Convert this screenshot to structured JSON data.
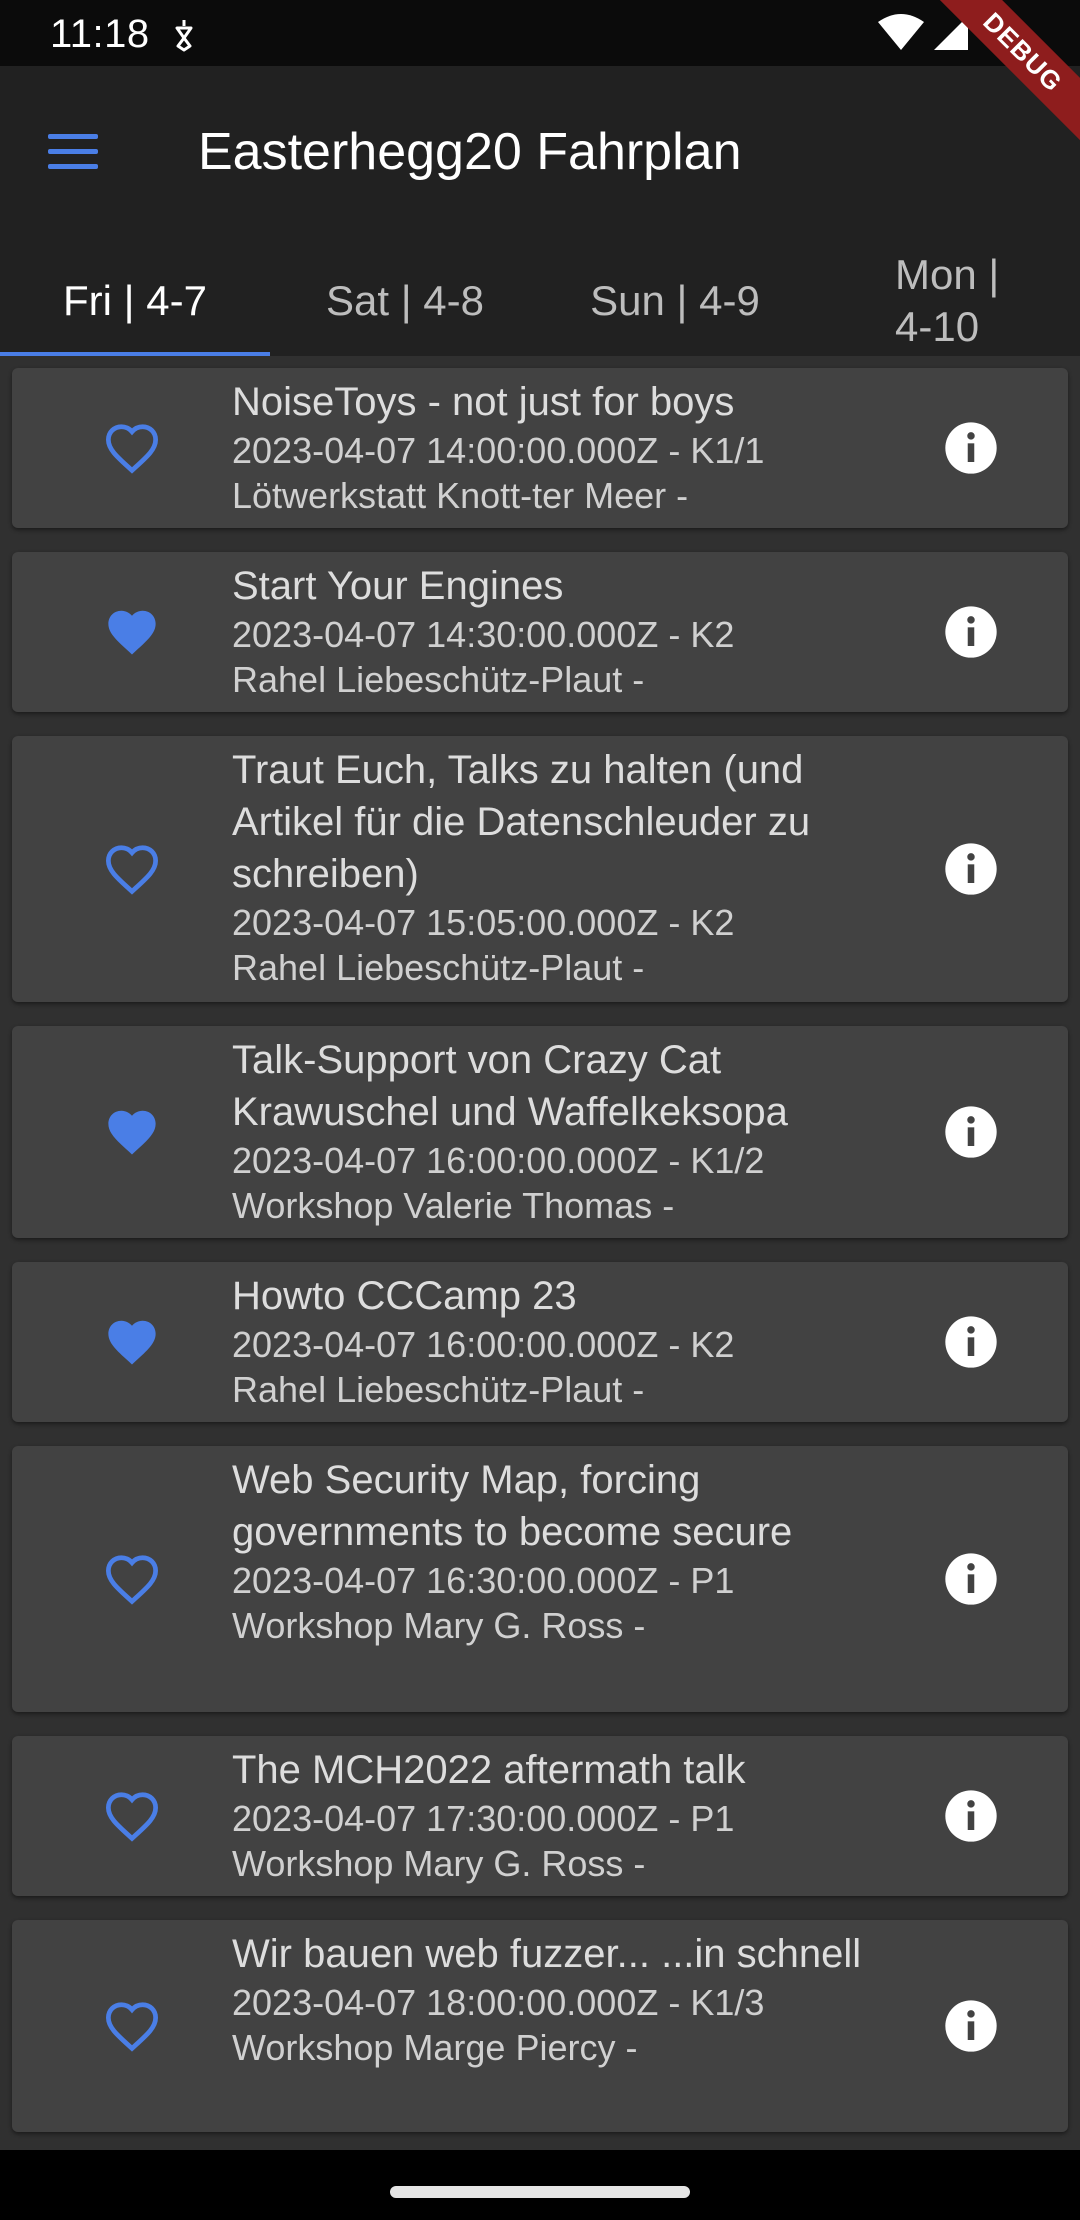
{
  "status_bar": {
    "time": "11:18"
  },
  "debug_banner": "DEBUG",
  "app_bar": {
    "title": "Easterhegg20 Fahrplan"
  },
  "colors": {
    "accent": "#4a7ee6",
    "card": "#424242",
    "appbar": "#212121"
  },
  "tabs": [
    {
      "label": "Fri | 4-7",
      "selected": true
    },
    {
      "label": "Sat | 4-8",
      "selected": false
    },
    {
      "label": "Sun | 4-9",
      "selected": false
    },
    {
      "label": "Mon |\n4-10",
      "selected": false
    }
  ],
  "events": [
    {
      "title": "NoiseToys - not just for boys",
      "datetime": "2023-04-07 14:00:00.000Z - K1/1",
      "speaker": "Lötwerkstatt Knott-ter Meer -",
      "favorite": false
    },
    {
      "title": "Start Your Engines",
      "datetime": "2023-04-07 14:30:00.000Z - K2",
      "speaker": "Rahel Liebeschütz-Plaut -",
      "favorite": true
    },
    {
      "title": "Traut Euch, Talks zu halten (und Artikel für die Datenschleuder zu schreiben)",
      "datetime": "2023-04-07 15:05:00.000Z - K2",
      "speaker": "Rahel Liebeschütz-Plaut -",
      "favorite": false
    },
    {
      "title": "Talk-Support von Crazy Cat Krawuschel und Waffelkeksopa",
      "datetime": "2023-04-07 16:00:00.000Z - K1/2",
      "speaker": "Workshop Valerie Thomas -",
      "favorite": true
    },
    {
      "title": "Howto CCCamp 23",
      "datetime": "2023-04-07 16:00:00.000Z - K2",
      "speaker": "Rahel Liebeschütz-Plaut -",
      "favorite": true
    },
    {
      "title": "Web Security Map, forcing governments to become secure",
      "datetime": "2023-04-07 16:30:00.000Z - P1",
      "speaker": "Workshop Mary G. Ross -",
      "favorite": false
    },
    {
      "title": "The MCH2022 aftermath talk",
      "datetime": "2023-04-07 17:30:00.000Z - P1",
      "speaker": "Workshop Mary G. Ross -",
      "favorite": false
    },
    {
      "title": "Wir bauen web fuzzer... ...in schnell",
      "datetime": "2023-04-07 18:00:00.000Z - K1/3",
      "speaker": "Workshop Marge Piercy -",
      "favorite": false
    }
  ]
}
